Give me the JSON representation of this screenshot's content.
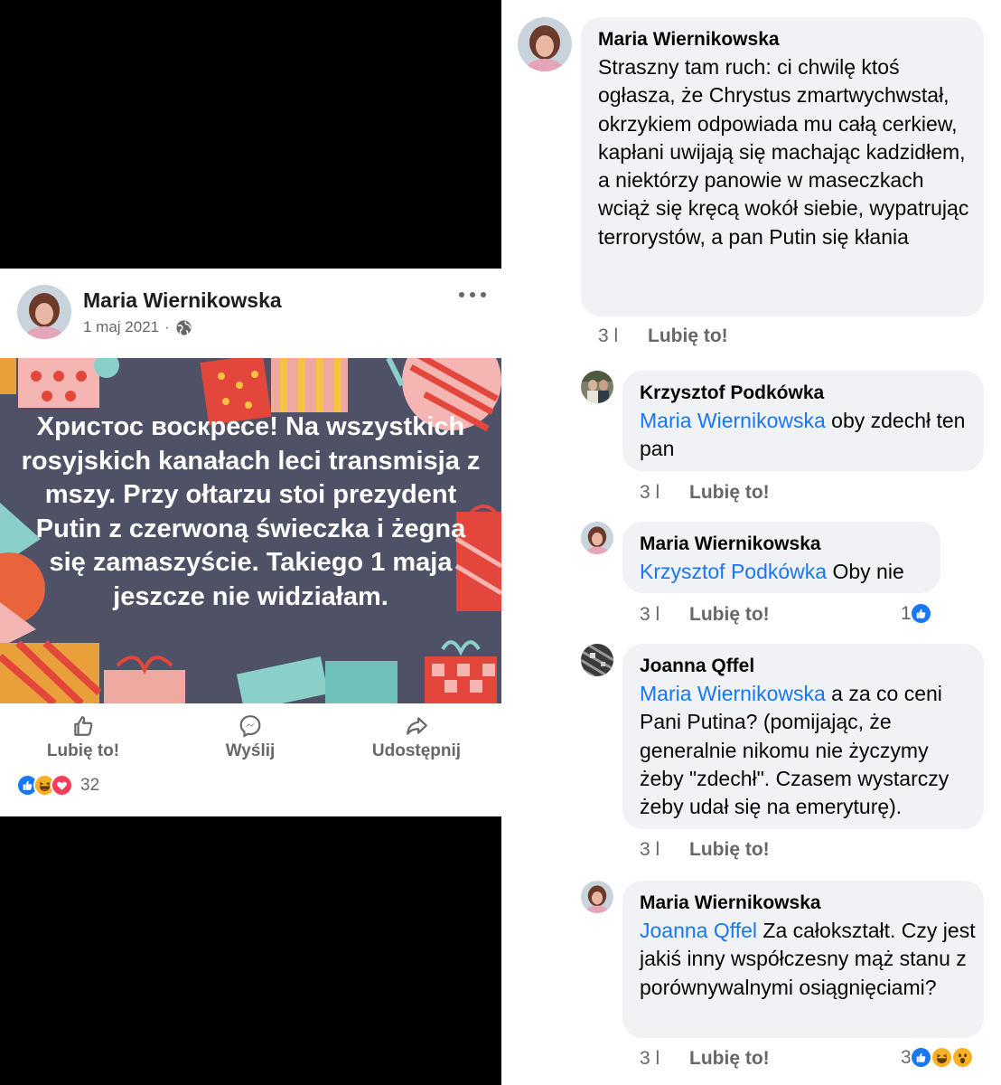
{
  "post": {
    "author": "Maria Wiernikowska",
    "date": "1 maj 2021",
    "dot": "·",
    "image_text": "Христос воскресе!  Na wszystkich rosyjskich kanałach leci transmisja z mszy. Przy ołtarzu stoi prezydent Putin z czerwoną świeczka i żegna się zamaszyście. Takiego 1 maja jeszcze nie widziałam.",
    "actions": {
      "like": "Lubię to!",
      "send": "Wyślij",
      "share": "Udostępnij"
    },
    "reaction_count": "32",
    "reaction_icons": [
      "like-icon",
      "haha-icon",
      "love-icon"
    ]
  },
  "comments": [
    {
      "author": "Maria Wiernikowska",
      "mention": "",
      "text": "Straszny tam ruch: ci chwilę ktoś ogłasza, że Chrystus zmartwychwstał, okrzykiem odpowiada mu całą cerkiew,  kapłani uwijają się machając  kadzidłem, a niektórzy panowie w maseczkach wciąż się kręcą wokół siebie, wypatrując terrorystów, a pan Putin się kłania",
      "time": "3 l",
      "like": "Lubię to!",
      "reactions": ""
    },
    {
      "author": "Krzysztof Podkówka",
      "mention": "Maria Wiernikowska",
      "text": " oby zdechł ten pan",
      "time": "3 l",
      "like": "Lubię to!",
      "reactions": ""
    },
    {
      "author": "Maria Wiernikowska",
      "mention": "Krzysztof Podkówka",
      "text": " Oby nie",
      "time": "3 l",
      "like": "Lubię to!",
      "reactions": "1"
    },
    {
      "author": "Joanna Qffel",
      "mention": "Maria Wiernikowska",
      "text": " a za co ceni Pani Putina? (pomijając, że generalnie nikomu nie życzymy żeby \"zdechł\". Czasem wystarczy żeby udał się na emeryturę).",
      "time": "3 l",
      "like": "Lubię to!",
      "reactions": ""
    },
    {
      "author": "Maria Wiernikowska",
      "mention": "Joanna Qffel",
      "text": " Za całokształt. Czy jest jakiś inny współczesny mąż stanu z porównywalnymi osiągnięciami?",
      "time": "3 l",
      "like": "Lubię to!",
      "reactions": "3"
    }
  ],
  "colors": {
    "mention": "#1877f2",
    "bubble": "#f0f2f5",
    "muted": "#65676b",
    "like_blue": "#1877f2",
    "love_red": "#f33e58",
    "haha_yellow": "#f7b125"
  }
}
